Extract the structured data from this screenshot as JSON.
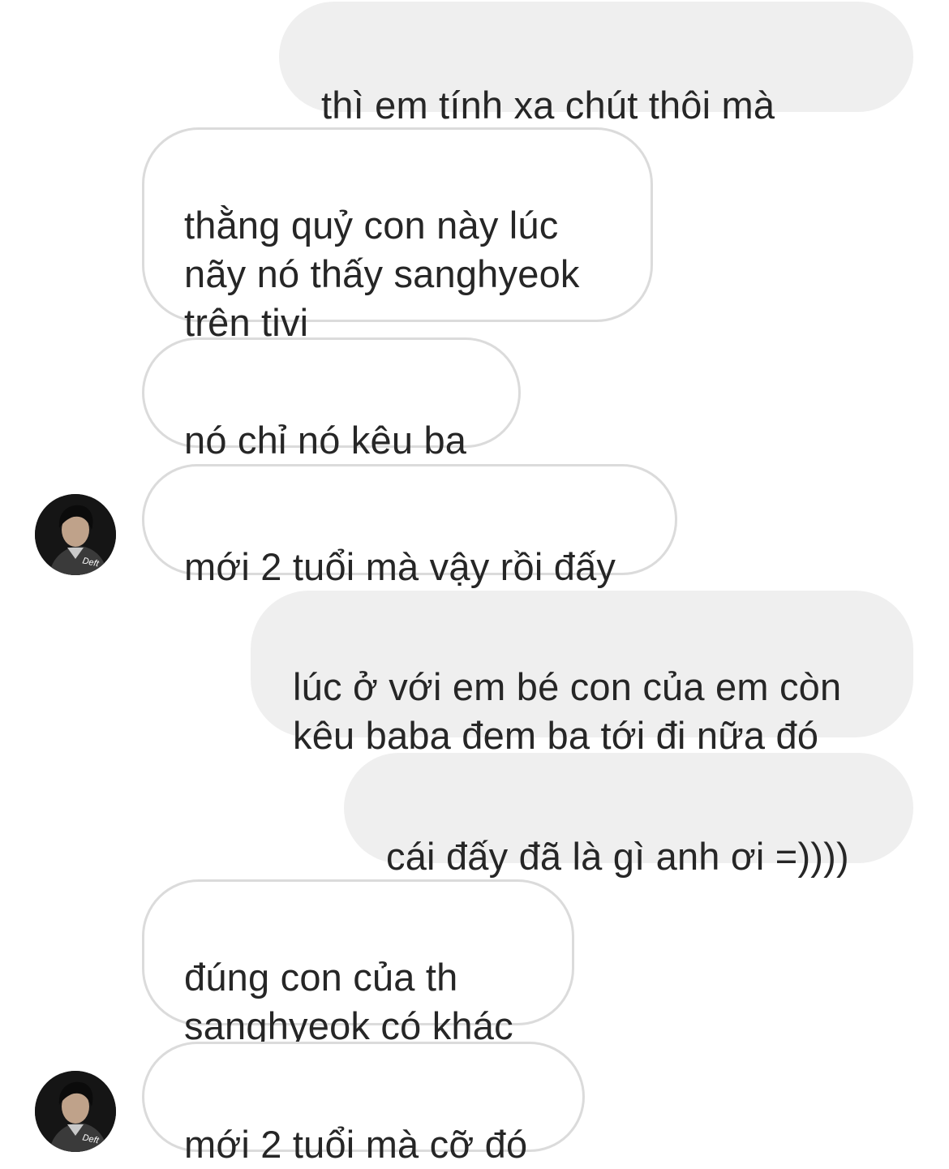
{
  "conversation": {
    "messages": [
      {
        "id": "m1",
        "sender": "me",
        "text": "thì em tính xa chút thôi mà",
        "emoji": "face-blowing-kiss-icon"
      },
      {
        "id": "m2",
        "sender": "other",
        "text": "thằng quỷ con này lúc\nnãy nó thấy sanghyeok\ntrên tivi"
      },
      {
        "id": "m3",
        "sender": "other",
        "text": "nó chỉ nó kêu ba"
      },
      {
        "id": "m4",
        "sender": "other",
        "text": "mới 2 tuổi mà vậy rồi đấy"
      },
      {
        "id": "m5",
        "sender": "me",
        "text": "lúc ở với em bé con của em còn\nkêu baba đem ba tới đi nữa đó"
      },
      {
        "id": "m6",
        "sender": "me",
        "text": "cái đấy đã là gì anh ơi =))))"
      },
      {
        "id": "m7",
        "sender": "other",
        "text": "đúng con của th\nsanghyeok có khác"
      },
      {
        "id": "m8",
        "sender": "other",
        "text": "mới 2 tuổi mà cỡ đó"
      }
    ],
    "avatar": {
      "caption": "Deft",
      "icon": "contact-avatar-icon"
    }
  },
  "colors": {
    "sent_bubble": "#efefef",
    "received_bubble": "#ffffff",
    "received_border": "#dbdbdb",
    "text": "#262626"
  }
}
